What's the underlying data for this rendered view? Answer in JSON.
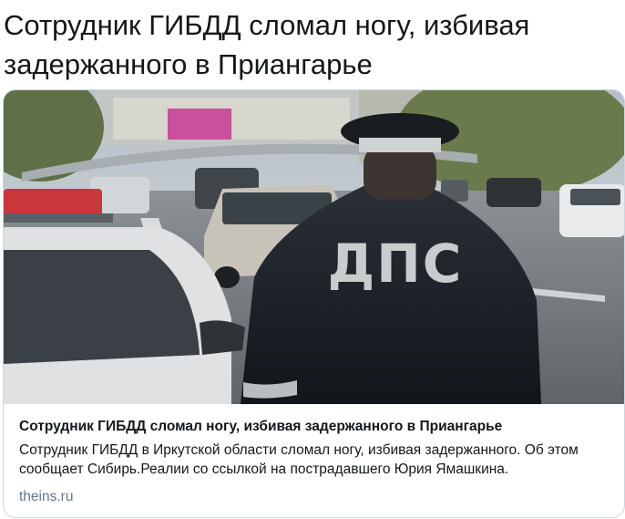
{
  "tweet": {
    "text": "Сотрудник ГИБДД сломал ногу, избивая задержанного в Приангарье"
  },
  "card": {
    "image": {
      "jacket_text": "ДПС"
    },
    "title": "Сотрудник ГИБДД сломал ногу, избивая задержанного в Приангарье",
    "description": "Сотрудник ГИБДД в Иркутской области сломал ногу, избивая задержанного. Об этом сообщает Сибирь.Реалии со ссылкой на пострадавшего Юрия Ямашкина.",
    "domain": "theins.ru"
  }
}
